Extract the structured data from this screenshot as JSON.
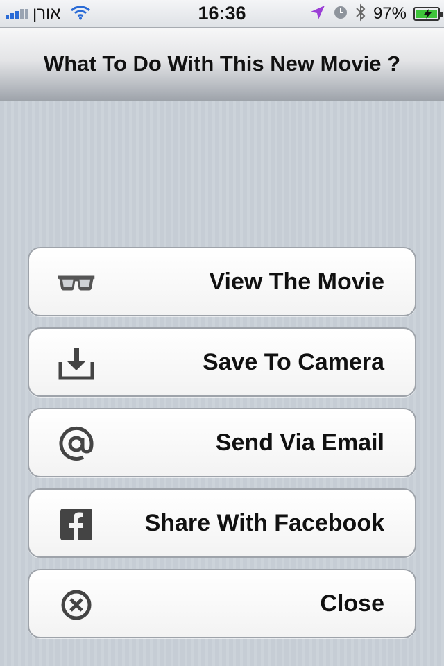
{
  "status_bar": {
    "carrier": "אורן",
    "time": "16:36",
    "battery": "97%"
  },
  "header": {
    "title": "What To Do With This New Movie ?"
  },
  "actions": [
    {
      "label": "View The Movie",
      "icon": "glasses-icon"
    },
    {
      "label": "Save To Camera",
      "icon": "download-icon"
    },
    {
      "label": "Send Via Email",
      "icon": "at-sign-icon"
    },
    {
      "label": "Share With Facebook",
      "icon": "facebook-icon"
    },
    {
      "label": "Close",
      "icon": "close-circle-icon"
    }
  ],
  "colors": {
    "background": "#c5ccd4",
    "button_border": "#9ea3aa",
    "battery_fill": "#3ec53a",
    "location_arrow": "#9b3fd6",
    "signal": "#2a6bd6"
  }
}
